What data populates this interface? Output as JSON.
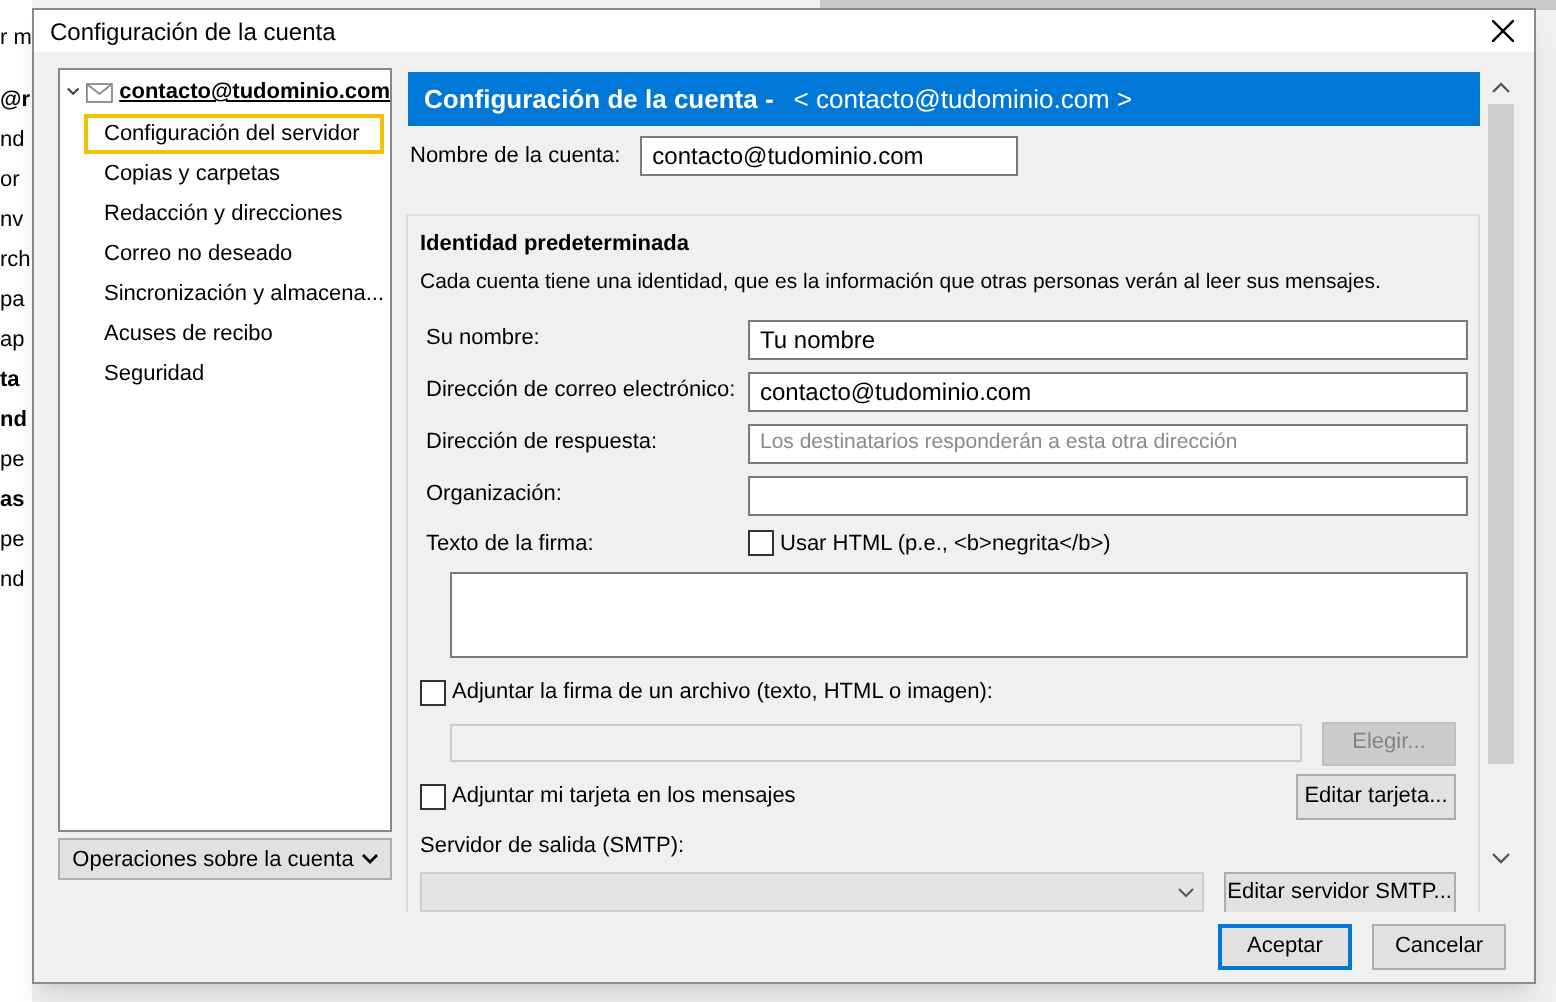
{
  "background_list": [
    "r m",
    "@r",
    "nd",
    "or",
    "nv",
    "rch",
    "pa",
    "ap",
    "ta",
    "nd",
    "pe",
    "as",
    "pe",
    "nd"
  ],
  "background_bold": [
    false,
    true,
    false,
    false,
    false,
    false,
    false,
    false,
    true,
    true,
    false,
    true,
    false,
    false
  ],
  "window": {
    "title": "Configuración de la cuenta"
  },
  "tree": {
    "account": "contacto@tudominio.com",
    "expanded": true,
    "items": [
      {
        "label": "Configuración del servidor",
        "selected": true
      },
      {
        "label": "Copias y carpetas",
        "selected": false
      },
      {
        "label": "Redacción y direcciones",
        "selected": false
      },
      {
        "label": "Correo no deseado",
        "selected": false
      },
      {
        "label": "Sincronización y almacena...",
        "selected": false
      },
      {
        "label": "Acuses de recibo",
        "selected": false
      },
      {
        "label": "Seguridad",
        "selected": false
      }
    ]
  },
  "account_actions": "Operaciones sobre la cuenta",
  "header": {
    "title": "Configuración de la cuenta -",
    "account": "< contacto@tudominio.com >"
  },
  "account_name": {
    "label": "Nombre de la cuenta:",
    "value": "contacto@tudominio.com"
  },
  "identity": {
    "title": "Identidad predeterminada",
    "description": "Cada cuenta tiene una identidad, que es la información que otras personas verán al leer sus mensajes.",
    "fields": [
      {
        "label": "Su nombre:",
        "value": "Tu nombre"
      },
      {
        "label": "Dirección de correo electrónico:",
        "value": "contacto@tudominio.com"
      },
      {
        "label": "Dirección de respuesta:",
        "placeholder": "Los destinatarios responderán a esta otra dirección"
      },
      {
        "label": "Organización:"
      }
    ],
    "signature_label": "Texto de la firma:",
    "use_html": {
      "label": "Usar HTML (p.e., <b>negrita</b>)",
      "checked": false
    },
    "attach_signature": {
      "label": "Adjuntar la firma de un archivo (texto, HTML o imagen):",
      "checked": false
    },
    "choose_button": {
      "label": "Elegir...",
      "disabled": true
    },
    "attach_card": {
      "label": "Adjuntar mi tarjeta en los mensajes",
      "checked": false
    },
    "edit_card_button": "Editar tarjeta...",
    "smtp_label": "Servidor de salida (SMTP):",
    "edit_smtp_button": "Editar servidor SMTP..."
  },
  "buttons": [
    "Aceptar",
    "Cancelar"
  ]
}
